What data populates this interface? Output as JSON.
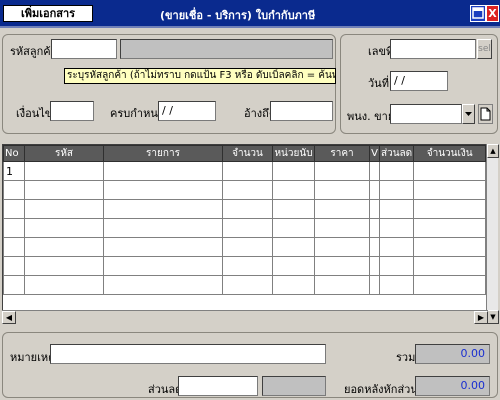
{
  "titlebar": {
    "badge": "เพิ่มเอกสาร",
    "title": "(ขายเชื่อ - บริการ)  ใบกำกับภาษี",
    "min_icon": "window-icon",
    "close_label": "X"
  },
  "customer": {
    "code_label": "รหัสลูกค้า",
    "code_value": "",
    "name_value": "",
    "hint": "ระบุรหัสลูกค้า (ถ้าไม่ทราบ กดแป้น F3  หรือ ดับเบิ้ลคลิก = ค้นหาลูกค้า)",
    "terms_label": "เงื่อนไข",
    "terms_value": "",
    "due_label": "ครบกำหนด",
    "due_value": " / /",
    "ref_label": "อ้างถึง",
    "ref_value": ""
  },
  "doc": {
    "number_label": "เลขที่",
    "number_value": "",
    "sel_label": "sel",
    "date_label": "วันที่",
    "date_value": " / /",
    "sales_label": "พนง. ขาย",
    "sales_value": "",
    "new_doc_icon": "document-icon"
  },
  "grid": {
    "columns": [
      "No",
      "รหัส",
      "รายการ",
      "จำนวน",
      "หน่วยนับ",
      "ราคา",
      "V",
      "ส่วนลด",
      "จำนวนเงิน"
    ],
    "rows": [
      [
        "1",
        "",
        "",
        "",
        "",
        "",
        "",
        "",
        ""
      ],
      [
        "",
        "",
        "",
        "",
        "",
        "",
        "",
        "",
        ""
      ],
      [
        "",
        "",
        "",
        "",
        "",
        "",
        "",
        "",
        ""
      ],
      [
        "",
        "",
        "",
        "",
        "",
        "",
        "",
        "",
        ""
      ],
      [
        "",
        "",
        "",
        "",
        "",
        "",
        "",
        "",
        ""
      ],
      [
        "",
        "",
        "",
        "",
        "",
        "",
        "",
        "",
        ""
      ],
      [
        "",
        "",
        "",
        "",
        "",
        "",
        "",
        "",
        ""
      ]
    ]
  },
  "footer": {
    "note_label": "หมายเหตุ",
    "note_value": "",
    "discount_label": "ส่วนลด",
    "discount_value": "",
    "discount_amount": "",
    "total_label": "รวม",
    "total_value": "0.00",
    "after_discount_label": "ยอดหลังหักส่วนลด",
    "after_discount_value": "0.00"
  },
  "colors": {
    "titlebar": "#0a2a8e",
    "grid_header": "#5a5a5a",
    "hint_bg": "#ffffc0",
    "amount_text": "#1a2fd0"
  }
}
